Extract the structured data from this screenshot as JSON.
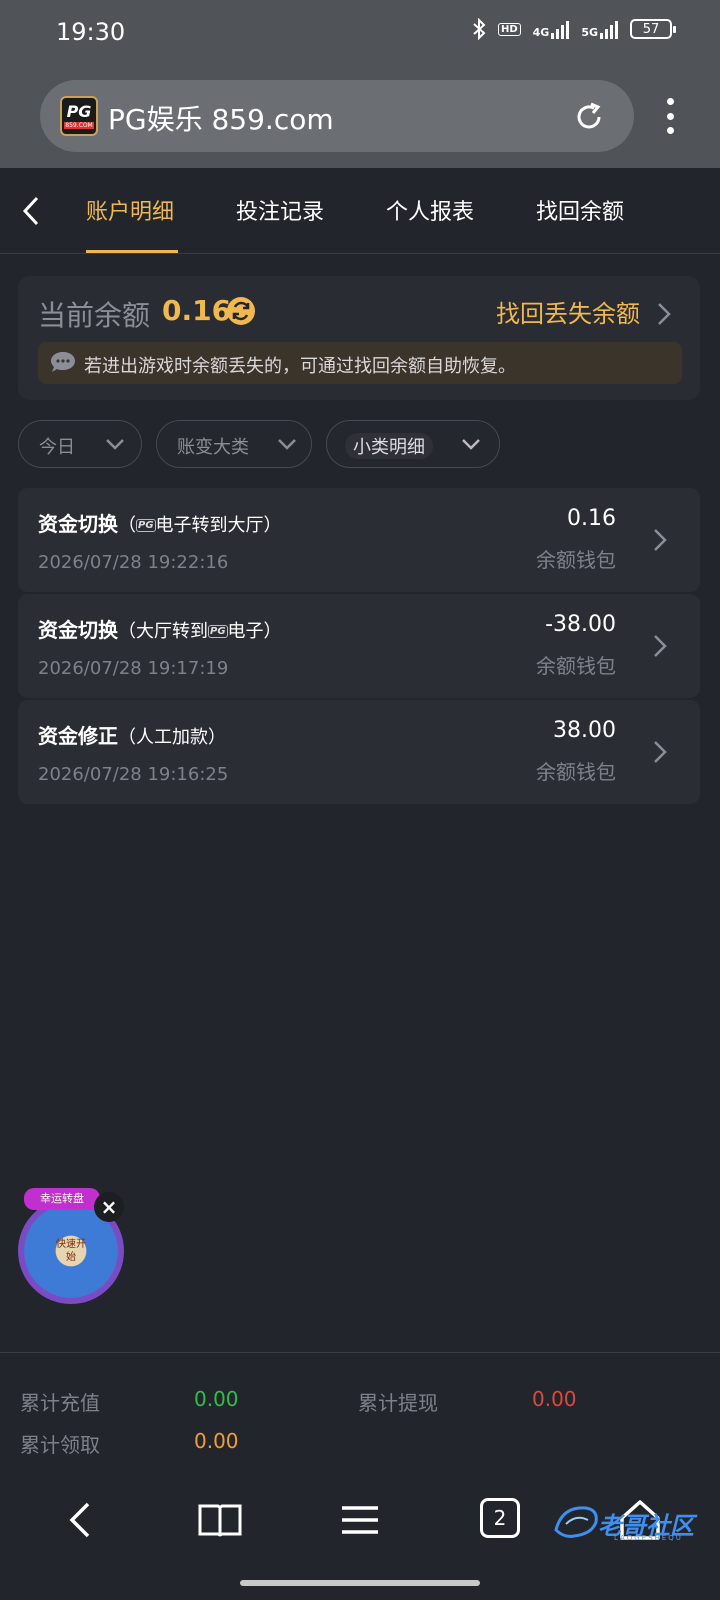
{
  "status": {
    "time": "19:30",
    "network_a": "4G",
    "network_b": "5G",
    "hd": "HD",
    "battery": "57"
  },
  "browser": {
    "url": "PG娱乐 859.com",
    "logo_text": "PG",
    "logo_domain": "859.COM"
  },
  "tabs": [
    {
      "label": "账户明细"
    },
    {
      "label": "投注记录"
    },
    {
      "label": "个人报表"
    },
    {
      "label": "找回余额"
    }
  ],
  "balance": {
    "label": "当前余额",
    "value": "0.16",
    "recover_link": "找回丢失余额",
    "notice": "若进出游戏时余额丢失的，可通过找回余额自助恢复。"
  },
  "filters": [
    {
      "label": "今日"
    },
    {
      "label": "账变大类"
    },
    {
      "label": "小类明细"
    }
  ],
  "records": [
    {
      "title": "资金切换",
      "sub_pre": "（",
      "sub_logo": "PG",
      "sub_text": "电子转到大厅）",
      "time": "2026/07/28 19:22:16",
      "amount": "0.16",
      "wallet": "余额钱包"
    },
    {
      "title": "资金切换",
      "sub_pre": "（大厅转到",
      "sub_logo": "PG",
      "sub_text": "电子）",
      "time": "2026/07/28 19:17:19",
      "amount": "-38.00",
      "wallet": "余额钱包"
    },
    {
      "title": "资金修正",
      "sub_pre": "（人工加款）",
      "sub_logo": "",
      "sub_text": "",
      "time": "2026/07/28 19:16:25",
      "amount": "38.00",
      "wallet": "余额钱包"
    }
  ],
  "promo": {
    "banner": "幸运转盘",
    "center": "快速开始"
  },
  "summary": {
    "deposit_label": "累计充值",
    "deposit_value": "0.00",
    "withdraw_label": "累计提现",
    "withdraw_value": "0.00",
    "claim_label": "累计领取",
    "claim_value": "0.00"
  },
  "nav": {
    "tab_count": "2"
  },
  "watermark": {
    "text": "老哥社区",
    "sub": "LAOGESHEQU"
  },
  "colors": {
    "accent": "#f0b84e",
    "green": "#2fbf4a",
    "red": "#e0483a",
    "orange": "#f0a030"
  }
}
